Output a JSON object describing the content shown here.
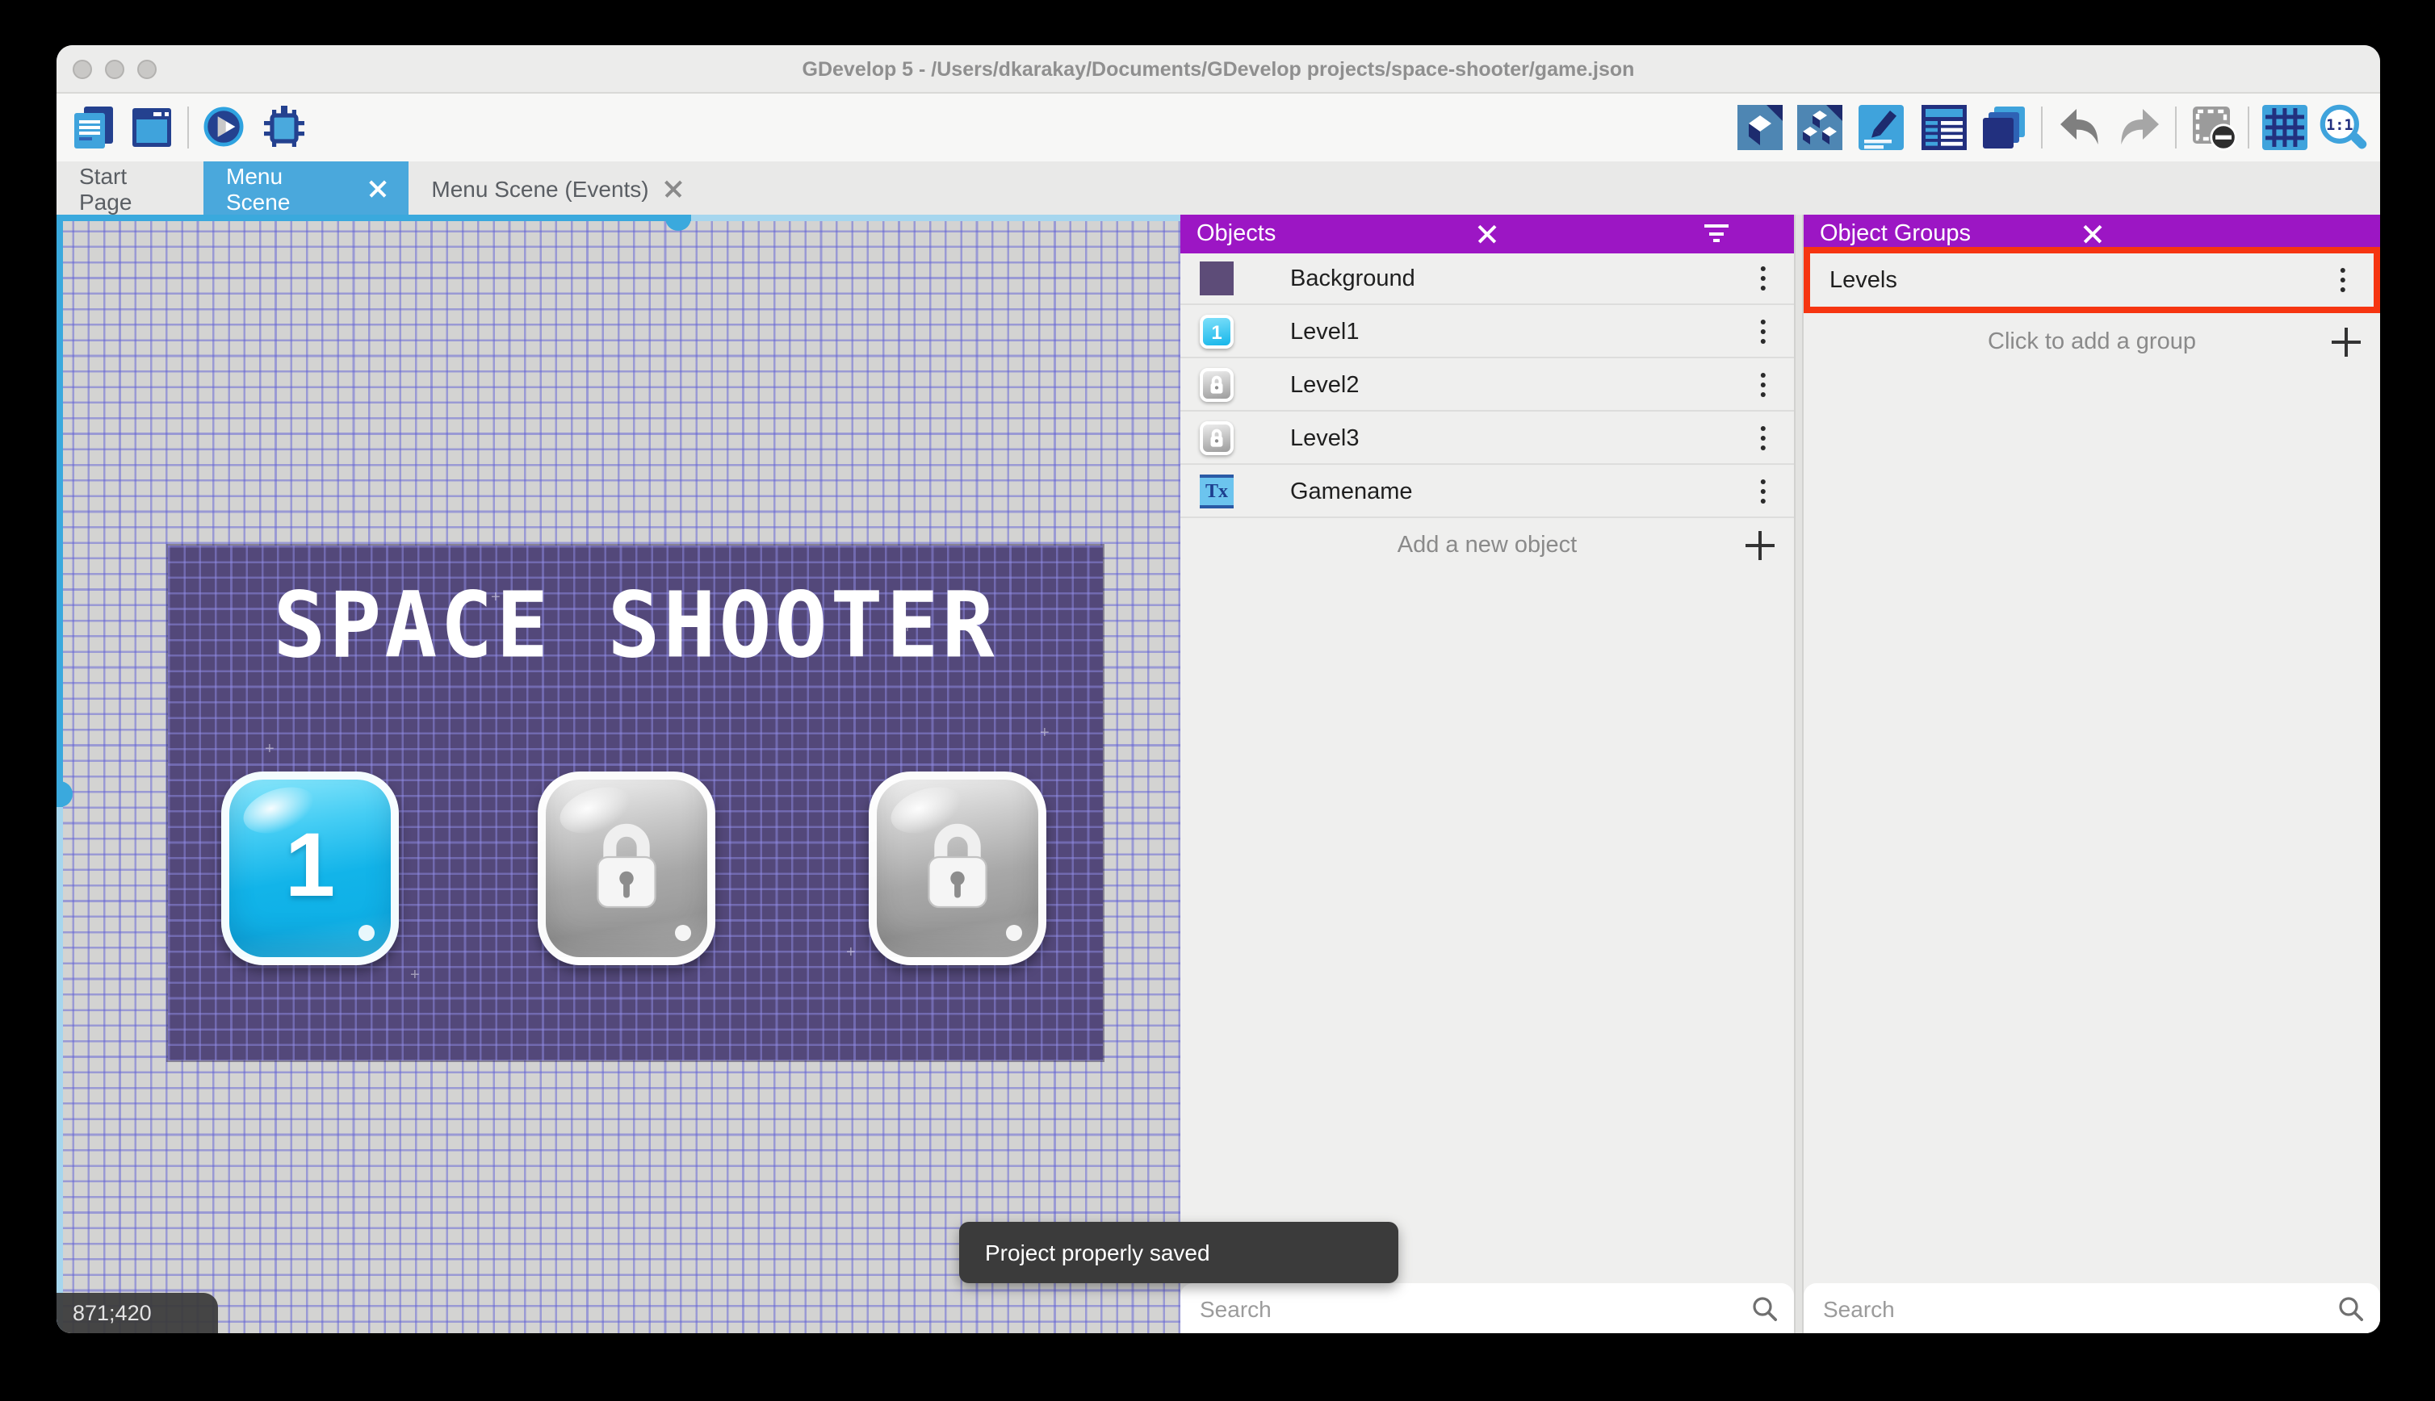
{
  "window": {
    "title": "GDevelop 5 - /Users/dkarakay/Documents/GDevelop projects/space-shooter/game.json"
  },
  "toolbar": {
    "left_icons": [
      "project-manager-icon",
      "open-scene-window-icon",
      "play-icon",
      "debug-icon"
    ],
    "right_icons": [
      "objects-editor-icon",
      "object-groups-icon",
      "properties-icon",
      "instances-list-icon",
      "layers-icon",
      "undo-icon",
      "redo-icon",
      "mask-icon",
      "grid-icon",
      "zoom-1-1-icon"
    ]
  },
  "tabs": [
    {
      "label": "Start Page",
      "active": false,
      "closable": false
    },
    {
      "label": "Menu Scene",
      "active": true,
      "closable": true
    },
    {
      "label": "Menu Scene (Events)",
      "active": false,
      "closable": true
    }
  ],
  "canvas": {
    "coordinate_badge": "871;420",
    "scene": {
      "title": "SPACE SHOOTER",
      "buttons": [
        {
          "label": "1",
          "state": "unlocked"
        },
        {
          "label": "",
          "state": "locked"
        },
        {
          "label": "",
          "state": "locked"
        }
      ]
    }
  },
  "objects_panel": {
    "title": "Objects",
    "items": [
      {
        "name": "Background",
        "thumb": "purple-color-swatch",
        "thumb_label": ""
      },
      {
        "name": "Level1",
        "thumb": "blue-button",
        "thumb_label": "1"
      },
      {
        "name": "Level2",
        "thumb": "gray-lock-button",
        "thumb_label": ""
      },
      {
        "name": "Level3",
        "thumb": "gray-lock-button",
        "thumb_label": ""
      },
      {
        "name": "Gamename",
        "thumb": "text-object",
        "thumb_label": "Tx"
      }
    ],
    "add_label": "Add a new object",
    "search_placeholder": "Search"
  },
  "groups_panel": {
    "title": "Object Groups",
    "items": [
      {
        "name": "Levels",
        "highlighted": true
      }
    ],
    "add_label": "Click to add a group",
    "search_placeholder": "Search"
  },
  "toast": {
    "message": "Project properly saved"
  },
  "colors": {
    "panel_header_purple": "#9c16c4",
    "active_tab_blue": "#4aa8dc",
    "annotation_red": "#f63511",
    "game_background_purple": "#53487a",
    "scrollbar_blue": "#3aa9dd"
  }
}
